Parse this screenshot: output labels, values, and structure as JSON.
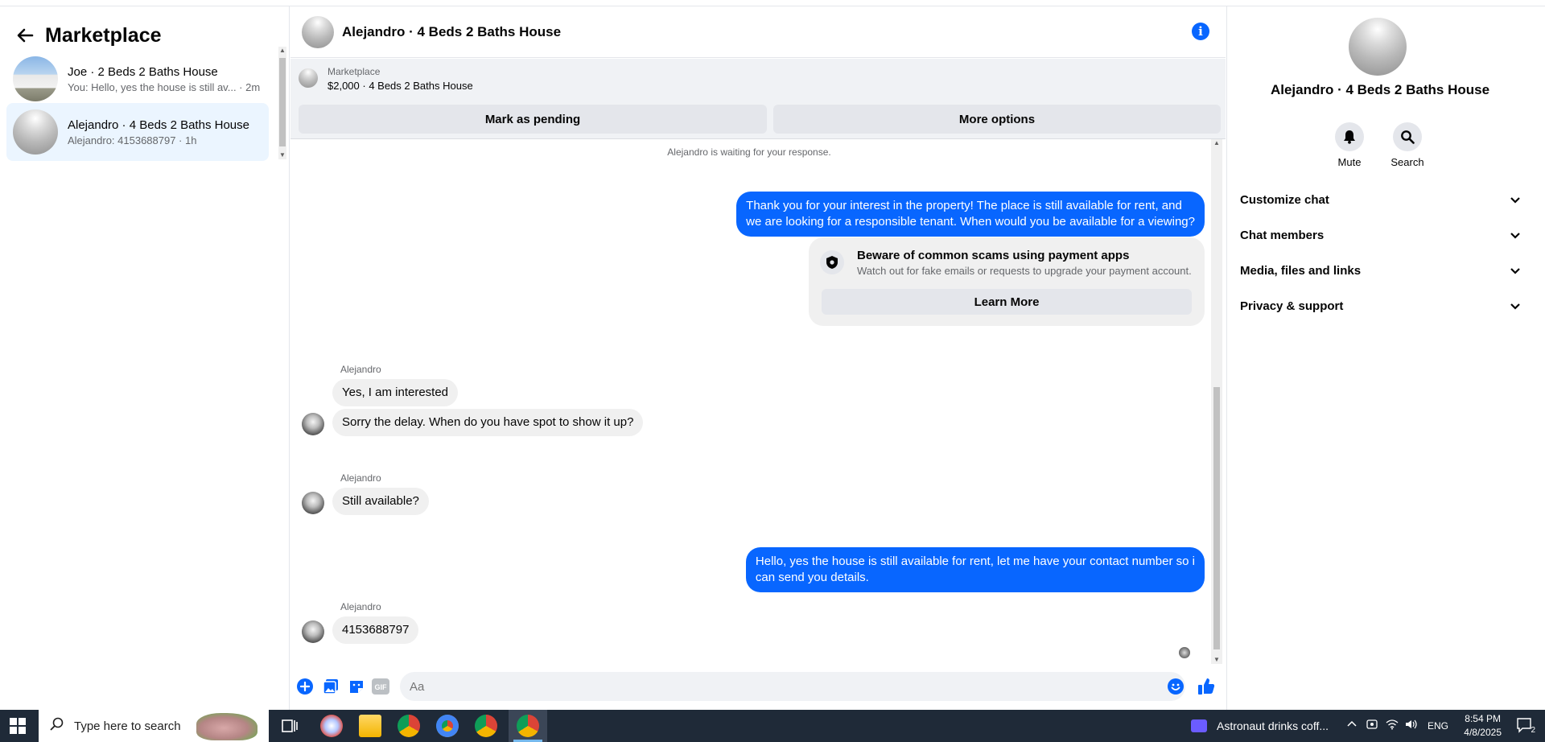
{
  "left": {
    "title": "Marketplace",
    "conversations": [
      {
        "title": "Joe · 2 Beds 2 Baths House",
        "preview": "You: Hello, yes the house is still av... · 2m"
      },
      {
        "title": "Alejandro · 4 Beds 2 Baths House",
        "preview": "Alejandro: 4153688797 · 1h"
      }
    ]
  },
  "chat": {
    "title": "Alejandro · 4 Beds 2 Baths House",
    "marketplace_label": "Marketplace",
    "listing": "$2,000 · 4 Beds 2 Baths House",
    "mark_pending": "Mark as pending",
    "more_options": "More options",
    "waiting": "Alejandro is waiting for your response.",
    "out1_line1": "Thank you for your interest in the property! The place is still available for rent, and",
    "out1_line2": "we are looking for a responsible tenant. When would you be available for a viewing?",
    "scam_title": "Beware of common scams using payment apps",
    "scam_sub": "Watch out for fake emails or requests to upgrade your payment account.",
    "learn_more": "Learn More",
    "sender": "Alejandro",
    "in1": "Yes, I am interested",
    "in2": "Sorry the delay. When do you have spot to show it up?",
    "in3": "Still available?",
    "out2_line1": "Hello, yes the house is still available for rent, let me have your contact number so i",
    "out2_line2": "can send you details.",
    "in4": "4153688797",
    "composer_placeholder": "Aa",
    "gif_label": "GIF"
  },
  "right": {
    "title": "Alejandro · 4 Beds 2 Baths House",
    "mute": "Mute",
    "search": "Search",
    "sections": [
      "Customize chat",
      "Chat members",
      "Media, files and links",
      "Privacy & support"
    ]
  },
  "taskbar": {
    "search_placeholder": "Type here to search",
    "media": "Astronaut drinks coff...",
    "lang": "ENG",
    "time": "8:54 PM",
    "date": "4/8/2025",
    "notif_count": "2"
  },
  "colors": {
    "accent": "#0866ff",
    "bubble_in": "#f0f0f0",
    "active_row": "#ebf5ff"
  }
}
